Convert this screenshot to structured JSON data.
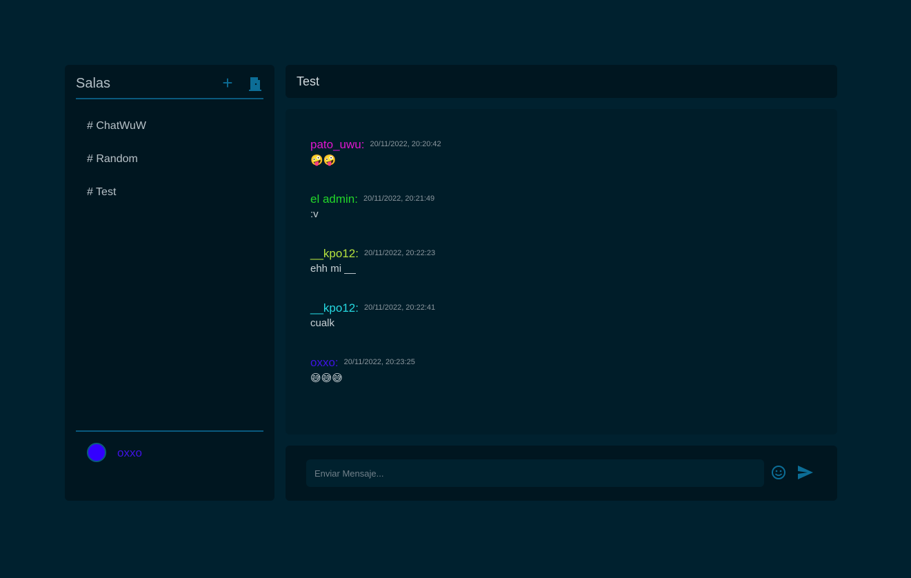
{
  "sidebar": {
    "title": "Salas",
    "add_icon": "plus-icon",
    "exit_icon": "door-exit-icon",
    "rooms": [
      {
        "label": "# ChatWuW"
      },
      {
        "label": "# Random"
      },
      {
        "label": "# Test"
      }
    ],
    "user": {
      "name": "oxxo",
      "color": "#3f13e5"
    }
  },
  "chat": {
    "title": "Test",
    "messages": [
      {
        "author": "pato_uwu:",
        "time": "20/11/2022, 20:20:42",
        "text": "🤪🤪",
        "color": "#e016d0"
      },
      {
        "author": "el admin:",
        "time": "20/11/2022, 20:21:49",
        "text": ":v",
        "color": "#22d62a"
      },
      {
        "author": "__kpo12:",
        "time": "20/11/2022, 20:22:23",
        "text": "ehh mi __",
        "color": "#b7e23e"
      },
      {
        "author": "__kpo12:",
        "time": "20/11/2022, 20:22:41",
        "text": "cualk",
        "color": "#25d8e0"
      },
      {
        "author": "oxxo:",
        "time": "20/11/2022, 20:23:25",
        "text": "😅😅😅",
        "color": "#3f13e5"
      }
    ]
  },
  "composer": {
    "placeholder": "Enviar Mensaje...",
    "emoji_icon": "smiley-icon",
    "send_icon": "send-icon"
  }
}
